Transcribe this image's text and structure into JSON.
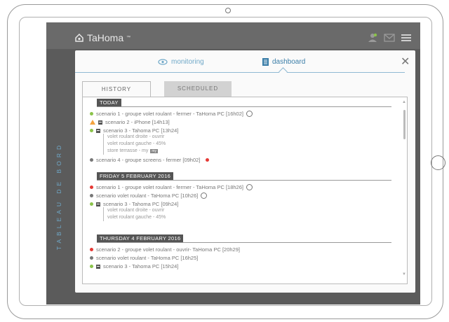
{
  "app": {
    "name": "TaHoma"
  },
  "side_label": "TABLEAU DE BORD",
  "nav": {
    "monitoring": "monitoring",
    "dashboard": "dashboard",
    "close": "✕"
  },
  "tabs": {
    "history": "HISTORY",
    "scheduled": "SCHEDULED"
  },
  "groups": [
    {
      "date": "TODAY",
      "rows": [
        {
          "status": "green",
          "text": "scenario 1 - groupe volet roulant - fermer - TaHoma PC [16h02]",
          "clock": true
        },
        {
          "status": "warning",
          "text": "scenario 2 - iPhone [14h13]",
          "expand": true
        },
        {
          "status": "green",
          "text": "scenario 3 - Tahoma PC [13h24]",
          "expand": true,
          "subs": [
            "volet roulant droite - ouvrir",
            "volet roulant gauche - 45%",
            "store terrasse - my"
          ],
          "sub_tag": "my"
        },
        {
          "status": "grey",
          "text": "scenario 4 - groupe screens - fermer [09h02]",
          "alert": true
        }
      ]
    },
    {
      "date": "FRIDAY 5 FEBRUARY 2016",
      "rows": [
        {
          "status": "red",
          "text": "scenario 1 - groupe volet roulant - fermer - TaHoma PC [18h26]",
          "clock": true
        },
        {
          "status": "grey",
          "text": "scenario volet roulant - TaHoma PC [10h26]",
          "clock": true
        },
        {
          "status": "green",
          "text": "scenario 3 - Tahoma PC [09h24]",
          "expand": true,
          "subs": [
            "volet roulant droite - ouvrir",
            "volet roulant gauche - 45%"
          ]
        }
      ]
    },
    {
      "date": "THURSDAY 4 FEBRUARY 2016",
      "rows": [
        {
          "status": "red",
          "text": "scenario 2 - groupe volet roulant - ouvrir- TaHoma PC [20h29]"
        },
        {
          "status": "grey",
          "text": "scenario volet roulant - TaHoma PC [16h25]"
        },
        {
          "status": "green",
          "text": "scenario 3 - Tahoma PC [15h24]",
          "expand": true
        }
      ]
    }
  ],
  "colors": {
    "accent": "#3b7ea8",
    "accent_light": "#6fa8c8",
    "green": "#8bc34a",
    "red": "#e53935",
    "warning": "#f4a340"
  }
}
